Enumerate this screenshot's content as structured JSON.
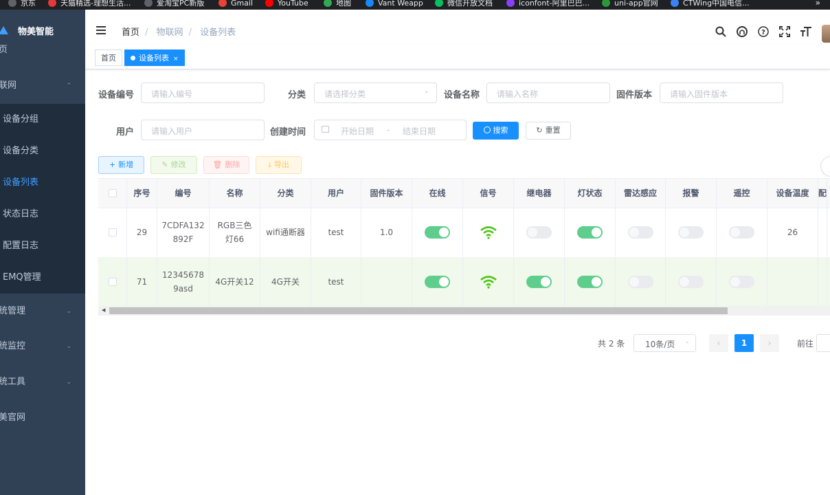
{
  "bookmarks": [
    {
      "label": "京东",
      "icon": "globe-icon",
      "color": "#5f6368"
    },
    {
      "label": "天猫精选-理想生活...",
      "icon": "tmall-icon",
      "color": "#e4393c"
    },
    {
      "label": "爱淘宝PC新版",
      "icon": "globe-icon",
      "color": "#5f6368"
    },
    {
      "label": "Gmail",
      "icon": "gmail-icon",
      "color": "#ea4335"
    },
    {
      "label": "YouTube",
      "icon": "youtube-icon",
      "color": "#ff0000"
    },
    {
      "label": "地图",
      "icon": "maps-icon",
      "color": "#34a853"
    },
    {
      "label": "Vant Weapp",
      "icon": "vant-icon",
      "color": "#1989fa"
    },
    {
      "label": "微信开放文档",
      "icon": "wechat-icon",
      "color": "#07c160"
    },
    {
      "label": "iconfont-阿里巴巴...",
      "icon": "iconfont-icon",
      "color": "#8a3ffc"
    },
    {
      "label": "uni-app官网",
      "icon": "uniapp-icon",
      "color": "#2b9939"
    },
    {
      "label": "CTWing中国电信...",
      "icon": "ctwing-icon",
      "color": "#3b82f6"
    }
  ],
  "bookmarks_more": "»",
  "sidebar": {
    "brand": "物美智能",
    "items": [
      {
        "label": "页",
        "level": "top",
        "arrow": ""
      },
      {
        "label": "联网",
        "level": "top",
        "arrow": "⌃"
      },
      {
        "label": "设备分组",
        "level": "sub",
        "arrow": ""
      },
      {
        "label": "设备分类",
        "level": "sub",
        "arrow": ""
      },
      {
        "label": "设备列表",
        "level": "sub",
        "arrow": "",
        "active": true
      },
      {
        "label": "状态日志",
        "level": "sub",
        "arrow": ""
      },
      {
        "label": "配置日志",
        "level": "sub",
        "arrow": ""
      },
      {
        "label": "EMQ管理",
        "level": "sub",
        "arrow": ""
      },
      {
        "label": "统管理",
        "level": "top",
        "arrow": "⌄"
      },
      {
        "label": "统监控",
        "level": "top",
        "arrow": "⌄"
      },
      {
        "label": "统工具",
        "level": "top",
        "arrow": "⌄"
      },
      {
        "label": "美官网",
        "level": "top",
        "arrow": ""
      }
    ]
  },
  "header": {
    "breadcrumb": [
      "首页",
      "物联网",
      "设备列表"
    ],
    "icons": [
      "search-icon",
      "github-icon",
      "help-icon",
      "fullscreen-icon",
      "font-size-icon"
    ]
  },
  "tags": [
    {
      "label": "首页",
      "active": false
    },
    {
      "label": "设备列表",
      "active": true,
      "close": "×"
    }
  ],
  "search": {
    "device_no": {
      "label": "设备编号",
      "placeholder": "请输入编号"
    },
    "category": {
      "label": "分类",
      "placeholder": "请选择分类"
    },
    "device_name": {
      "label": "设备名称",
      "placeholder": "请输入名称"
    },
    "firmware": {
      "label": "固件版本",
      "placeholder": "请输入固件版本"
    },
    "user": {
      "label": "用户",
      "placeholder": "请输入用户"
    },
    "created": {
      "label": "创建时间",
      "start_placeholder": "开始日期",
      "separator": "-",
      "end_placeholder": "结束日期"
    },
    "search_btn": "搜索",
    "reset_btn": "重置"
  },
  "toolbar": {
    "add": "新增",
    "edit": "修改",
    "delete": "删除",
    "export": "导出"
  },
  "table": {
    "columns": [
      "序号",
      "编号",
      "名称",
      "分类",
      "用户",
      "固件版本",
      "在线",
      "信号",
      "继电器",
      "灯状态",
      "雷达感应",
      "报警",
      "遥控",
      "设备温度",
      "配"
    ],
    "rows": [
      {
        "id": "29",
        "code": "7CDFA132892F",
        "name": "RGB三色灯66",
        "category": "wifi通断器",
        "user": "test",
        "firmware": "1.0",
        "online": true,
        "signal": true,
        "relay": false,
        "light": true,
        "radar": false,
        "alarm": false,
        "remote": false,
        "temp": "26"
      },
      {
        "id": "71",
        "code": "123456789asd",
        "name": "4G开关12",
        "category": "4G开关",
        "user": "test",
        "firmware": "",
        "online": true,
        "signal": true,
        "relay": true,
        "light": true,
        "radar": false,
        "alarm": false,
        "remote": false,
        "temp": ""
      }
    ]
  },
  "pagination": {
    "total": "共 2 条",
    "page_size": "10条/页",
    "prev": "‹",
    "current": "1",
    "next": "›",
    "goto": "前往"
  },
  "colors": {
    "sidebar_bg": "#304156",
    "accent": "#1890ff",
    "switch_on": "#5fce8c",
    "signal": "#52c41a"
  }
}
